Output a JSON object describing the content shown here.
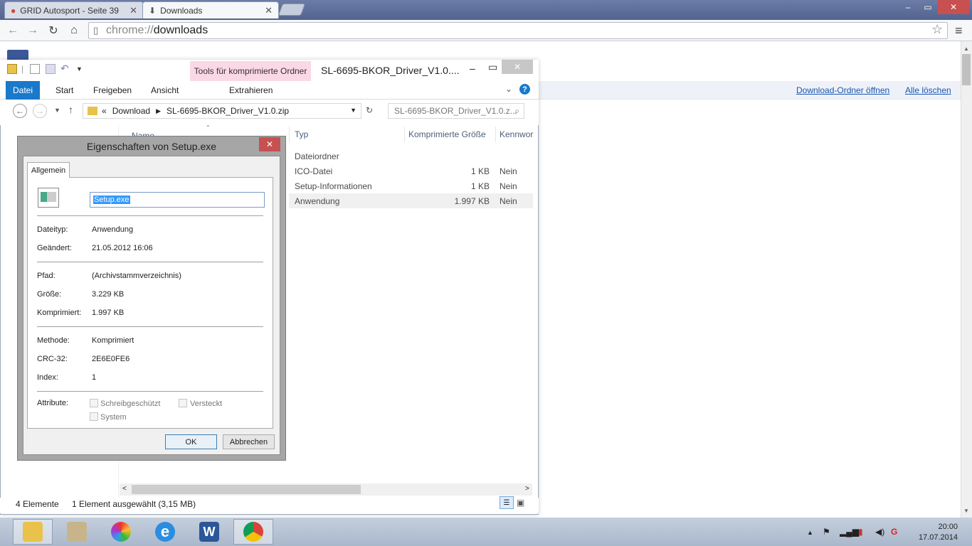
{
  "browser": {
    "tabs": [
      {
        "title": "GRID Autosport - Seite 39"
      },
      {
        "title": "Downloads"
      }
    ],
    "url_scheme": "chrome://",
    "url_path": "downloads",
    "window_controls": {
      "minimize": "–",
      "restore": "▭",
      "close": "✕"
    }
  },
  "downloads_page": {
    "open_folder_link": "Download-Ordner öffnen",
    "clear_all_link": "Alle löschen"
  },
  "explorer": {
    "title": "SL-6695-BKOR_Driver_V1.0....",
    "tools_tab": "Tools für komprimierte Ordner",
    "ribbon_tabs": [
      "Datei",
      "Start",
      "Freigeben",
      "Ansicht"
    ],
    "extract_tab": "Extrahieren",
    "breadcrumb": {
      "prefix": "«",
      "folder": "Download",
      "zip": "SL-6695-BKOR_Driver_V1.0.zip"
    },
    "search_placeholder": "SL-6695-BKOR_Driver_V1.0.z...",
    "columns": {
      "name": "Name",
      "type": "Typ",
      "size": "Komprimierte Größe",
      "password": "Kennwor"
    },
    "rows": [
      {
        "type": "Dateiordner",
        "size": "",
        "password": ""
      },
      {
        "type": "ICO-Datei",
        "size": "1 KB",
        "password": "Nein"
      },
      {
        "type": "Setup-Informationen",
        "size": "1 KB",
        "password": "Nein"
      },
      {
        "type": "Anwendung",
        "size": "1.997 KB",
        "password": "Nein"
      }
    ],
    "status_count": "4 Elemente",
    "status_selected": "1 Element ausgewählt (3,15 MB)"
  },
  "dialog": {
    "title": "Eigenschaften von Setup.exe",
    "tab": "Allgemein",
    "filename": "Setup.exe",
    "filetype_label": "Dateityp:",
    "filetype": "Anwendung",
    "modified_label": "Geändert:",
    "modified": "21.05.2012 16:06",
    "path_label": "Pfad:",
    "path": "(Archivstammverzeichnis)",
    "size_label": "Größe:",
    "size": "3.229 KB",
    "compressed_label": "Komprimiert:",
    "compressed": "1.997 KB",
    "method_label": "Methode:",
    "method": "Komprimiert",
    "crc_label": "CRC-32:",
    "crc": "2E6E0FE6",
    "index_label": "Index:",
    "index": "1",
    "attributes_label": "Attribute:",
    "attr_readonly": "Schreibgeschützt",
    "attr_hidden": "Versteckt",
    "attr_system": "System",
    "ok": "OK",
    "cancel": "Abbrechen"
  },
  "taskbar": {
    "time": "20:00",
    "date": "17.07.2014",
    "apps": [
      "file-explorer-icon",
      "scroll-app-icon",
      "picasa-icon",
      "internet-explorer-icon",
      "word-icon",
      "chrome-icon"
    ]
  }
}
